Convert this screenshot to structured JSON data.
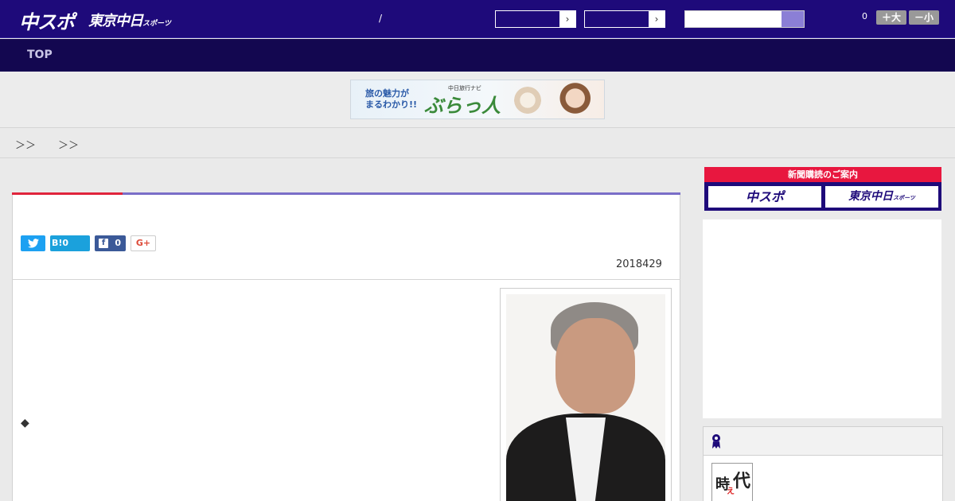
{
  "header": {
    "logo_chuspo": "中スポ",
    "logo_tokyo": "東京中日",
    "logo_tokyo_sub": "スポーツ",
    "separator": "/",
    "select1_value": "",
    "select2_value": "",
    "search_placeholder": "",
    "font_size_count": "0",
    "font_larger_label": "＋大",
    "font_smaller_label": "－小",
    "colors": {
      "bar": "#1e0a7a",
      "accent": "#8b7fd6"
    }
  },
  "nav": {
    "top_label": "TOP"
  },
  "banner": {
    "line1": "旅の魅力が",
    "line2": "まるわかり!!",
    "brand_small": "中日旅行ナビ",
    "brand": "ぶらっ人"
  },
  "breadcrumb": {
    "sep1": "＞＞",
    "sep2": "＞＞"
  },
  "article": {
    "share": {
      "twitter_icon": "twitter-icon",
      "hatena_label": "B!0",
      "facebook_count": "0",
      "gplus_label": "G+"
    },
    "date": "2018429",
    "bullet": "◆",
    "colors": {
      "top_accent": "#e0243c",
      "top_line": "#7a6ec8"
    }
  },
  "sidebar": {
    "subscription_header": "新聞購読のご案内",
    "sub_logo_1": "中スポ",
    "sub_logo_2": "東京中日",
    "sub_logo_2_sub": "スポーツ",
    "ranking_thumb_text": {
      "a": "時",
      "b": "代",
      "c": "え"
    }
  }
}
